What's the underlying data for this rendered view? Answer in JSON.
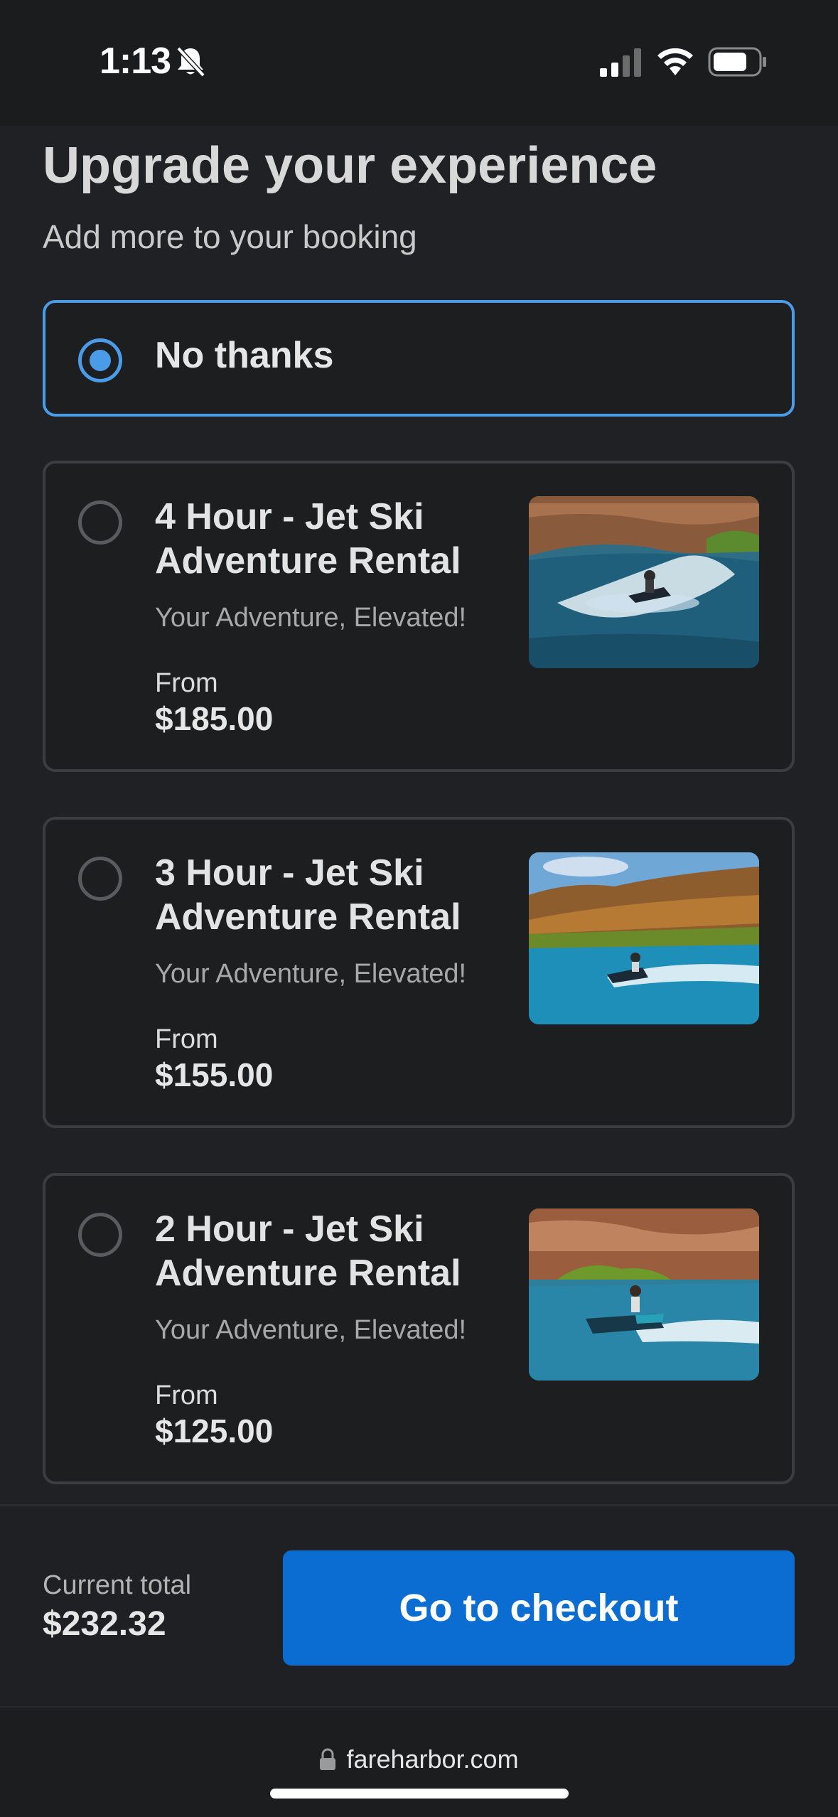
{
  "status_bar": {
    "time": "1:13",
    "icons": [
      "bell-slash-icon",
      "signal-icon",
      "wifi-icon",
      "battery-icon"
    ]
  },
  "header": {
    "title": "Upgrade your experience",
    "subtitle": "Add more to your booking"
  },
  "no_thanks": {
    "label": "No thanks",
    "selected": true
  },
  "options": [
    {
      "title": "4 Hour - Jet Ski Adventure Rental",
      "subtitle": "Your Adventure, Elevated!",
      "from_label": "From",
      "price": "$185.00",
      "selected": false
    },
    {
      "title": "3 Hour - Jet Ski Adventure Rental",
      "subtitle": "Your Adventure, Elevated!",
      "from_label": "From",
      "price": "$155.00",
      "selected": false
    },
    {
      "title": "2 Hour - Jet Ski Adventure Rental",
      "subtitle": "Your Adventure, Elevated!",
      "from_label": "From",
      "price": "$125.00",
      "selected": false
    }
  ],
  "footer": {
    "total_label": "Current total",
    "total_value": "$232.32",
    "checkout_label": "Go to checkout"
  },
  "browser": {
    "url": "fareharbor.com"
  },
  "colors": {
    "accent": "#4a9be8",
    "button": "#0b6dd1",
    "background": "#202124"
  }
}
